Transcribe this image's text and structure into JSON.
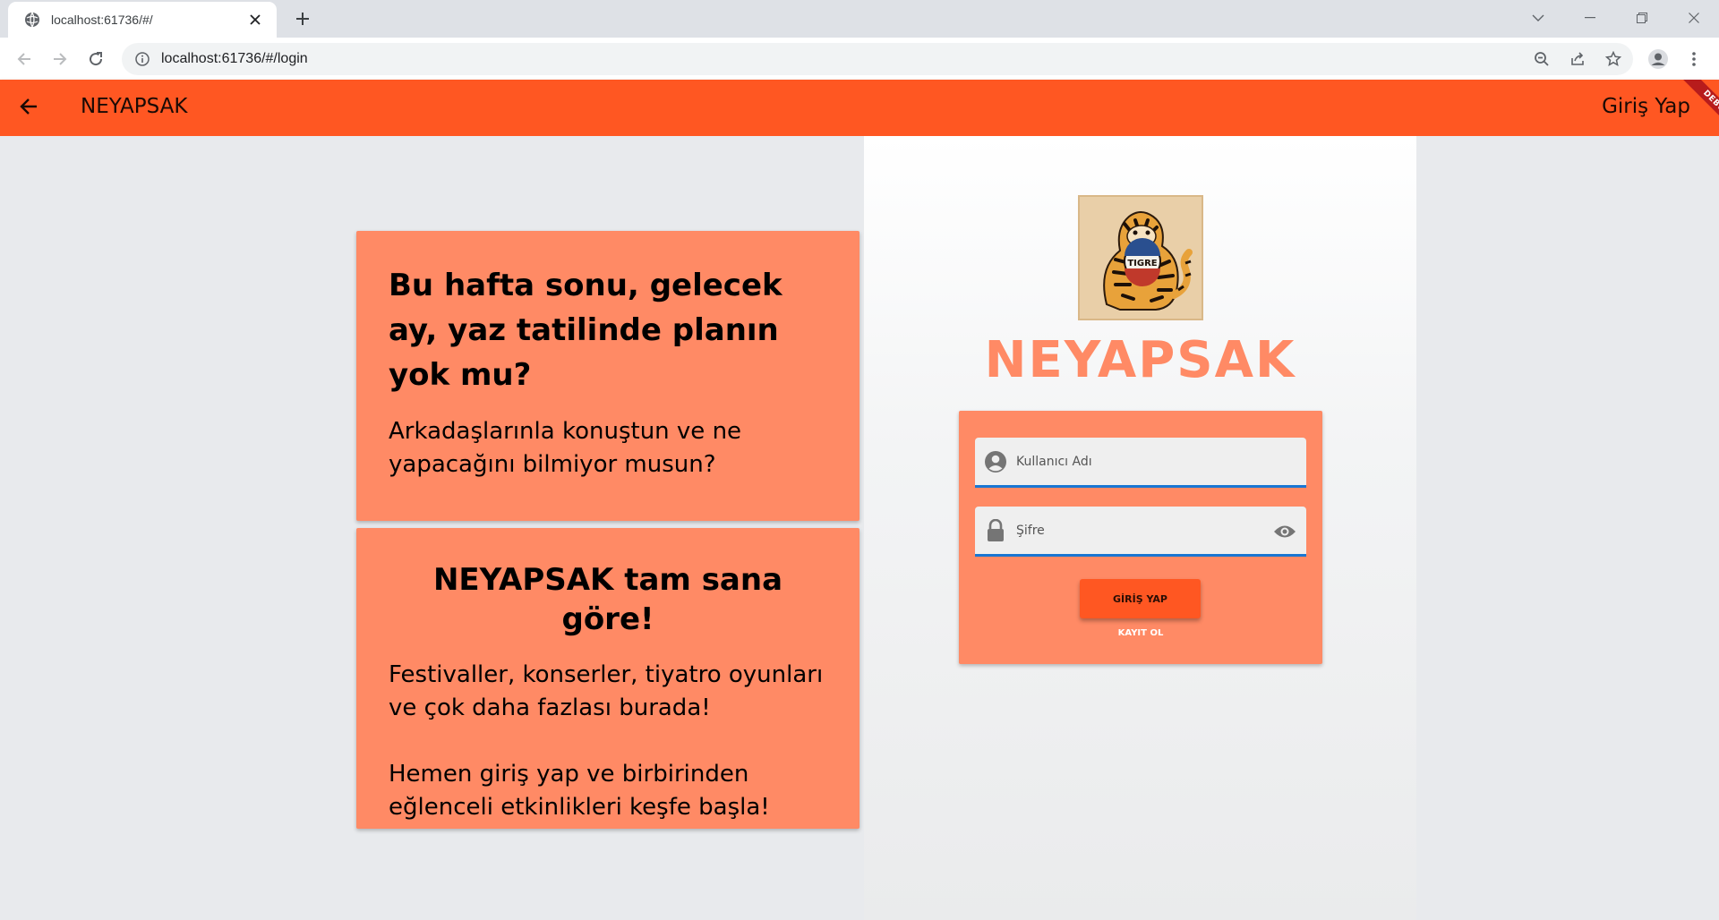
{
  "browser": {
    "tab_title": "localhost:61736/#/",
    "url": "localhost:61736/#/login",
    "icons": [
      "globe-icon",
      "close-icon",
      "plus-icon",
      "chevron-down-icon",
      "minimize-icon",
      "restore-icon",
      "window-close-icon",
      "back-arrow-icon",
      "forward-arrow-icon",
      "reload-icon",
      "info-icon",
      "zoom-out-icon",
      "share-icon",
      "star-icon",
      "profile-icon",
      "more-vert-icon"
    ]
  },
  "appbar": {
    "title": "NEYAPSAK",
    "action": "Giriş Yap",
    "debug": "DEBUG",
    "color": "#ff5722"
  },
  "card1": {
    "heading": "Bu hafta sonu, gelecek ay, yaz tatilinde planın yok mu?",
    "text": "Arkadaşlarınla konuştun ve ne yapacağını bilmiyor musun?"
  },
  "card2": {
    "heading": "NEYAPSAK tam sana göre!",
    "text1": "Festivaller, konserler, tiyatro oyunları ve çok daha fazlası burada!",
    "text2": "Hemen giriş yap ve birbirinden eğlenceli etkinlikleri keşfe başla!"
  },
  "login": {
    "logo_text": "TIGRE",
    "brand": "NEYAPSAK",
    "username_placeholder": "Kullanıcı Adı",
    "password_placeholder": "Şifre",
    "login_button": "GİRİŞ YAP",
    "register_button": "KAYIT OL",
    "accent_color": "#ff8a65",
    "field_underline_color": "#1976d2"
  }
}
